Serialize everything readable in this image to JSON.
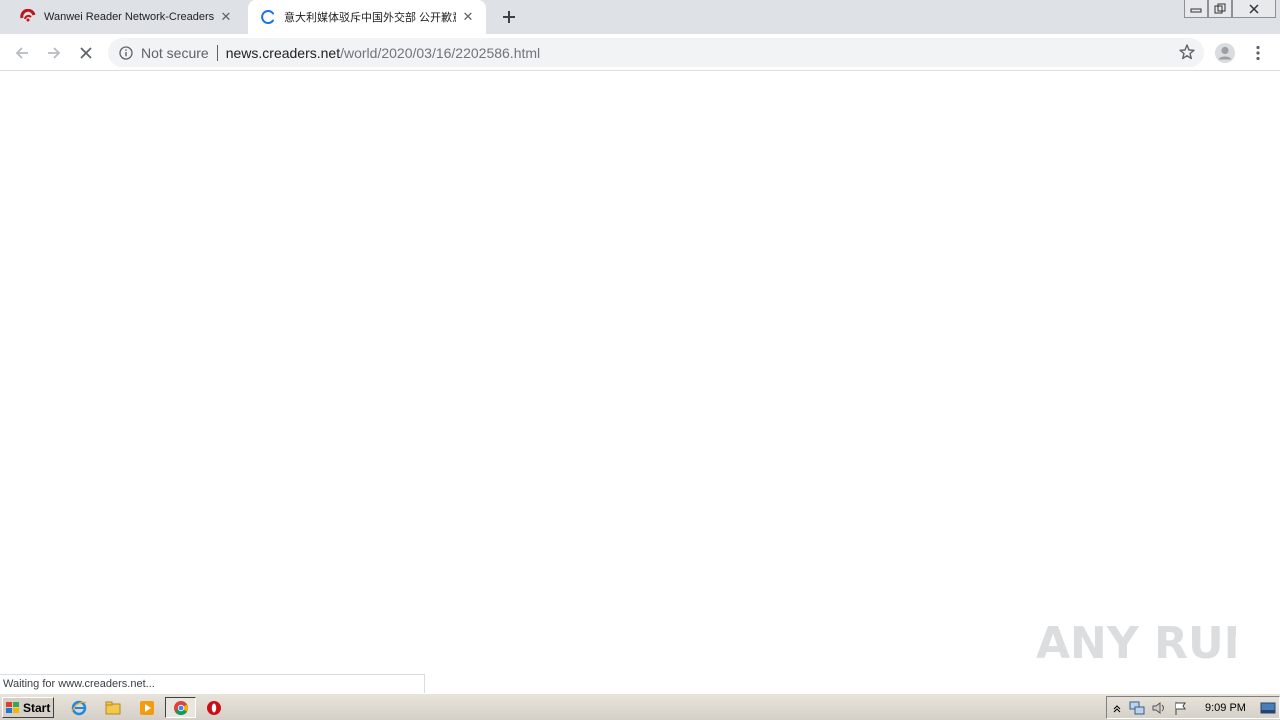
{
  "tabs": [
    {
      "title": "Wanwei Reader Network-Creaders.NET",
      "state": "loaded",
      "favicon": "creaders-logo-icon"
    },
    {
      "title": "意大利媒体驳斥中国外交部 公开歉意",
      "state": "loading",
      "favicon": "loading-spinner-icon"
    }
  ],
  "toolbar": {
    "security_label": "Not secure",
    "url_host": "news.creaders.net",
    "url_path": "/world/2020/03/16/2202586.html"
  },
  "status_bar": {
    "text": "Waiting for www.creaders.net..."
  },
  "watermark": {
    "text": "ANY RUN"
  },
  "taskbar": {
    "start_label": "Start",
    "apps": [
      "internet-explorer-icon",
      "file-explorer-icon",
      "media-player-icon",
      "chrome-icon",
      "opera-icon"
    ],
    "clock": "9:09 PM"
  },
  "colors": {
    "tab_strip": "#dee1e6",
    "omnibox": "#f1f3f4",
    "loading_accent": "#1a73e8",
    "favicon_red": "#c0141b"
  }
}
